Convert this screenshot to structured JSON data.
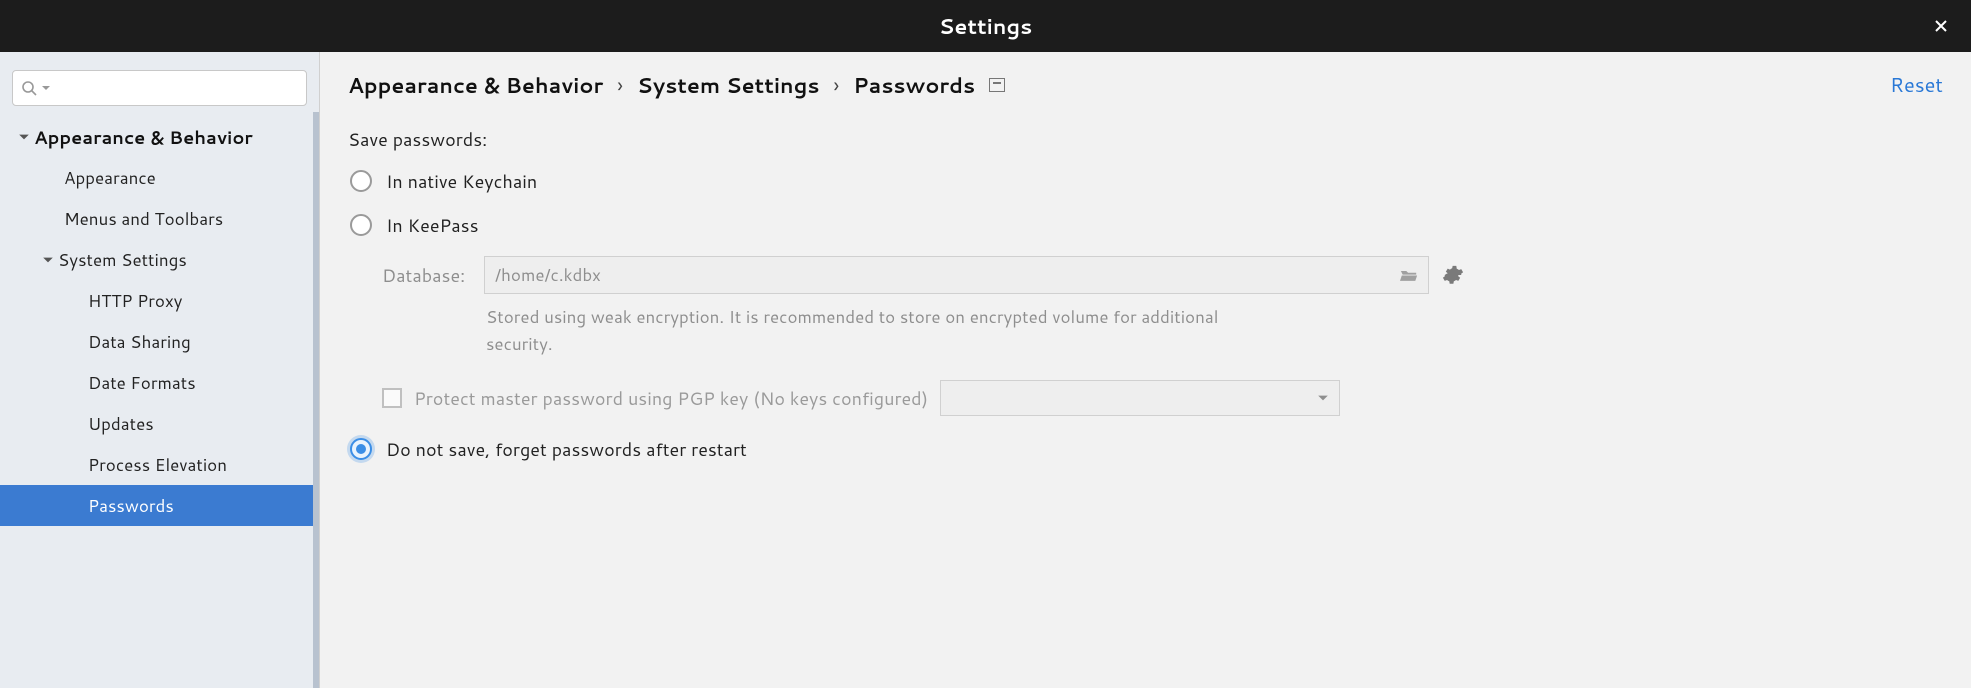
{
  "window": {
    "title": "Settings"
  },
  "sidebar": {
    "search_placeholder": "",
    "items": [
      {
        "label": "Appearance & Behavior",
        "level": 0,
        "expanded": true
      },
      {
        "label": "Appearance",
        "level": 1
      },
      {
        "label": "Menus and Toolbars",
        "level": 1
      },
      {
        "label": "System Settings",
        "level": 1,
        "expanded": true,
        "haschev": true
      },
      {
        "label": "HTTP Proxy",
        "level": 2
      },
      {
        "label": "Data Sharing",
        "level": 2
      },
      {
        "label": "Date Formats",
        "level": 2
      },
      {
        "label": "Updates",
        "level": 2
      },
      {
        "label": "Process Elevation",
        "level": 2
      },
      {
        "label": "Passwords",
        "level": 2,
        "selected": true
      }
    ]
  },
  "breadcrumb": {
    "root": "Appearance & Behavior",
    "mid": "System Settings",
    "leaf": "Passwords",
    "reset": "Reset"
  },
  "pane": {
    "heading": "Save passwords:",
    "option_native": "In native Keychain",
    "option_keepass": "In KeePass",
    "database_label": "Database:",
    "database_value": "/home/c.kdbx",
    "database_help": "Stored using weak encryption. It is recommended to store on encrypted volume for additional security.",
    "pgp_label": "Protect master password using PGP key (No keys configured)",
    "option_donotsave": "Do not save, forget passwords after restart"
  }
}
